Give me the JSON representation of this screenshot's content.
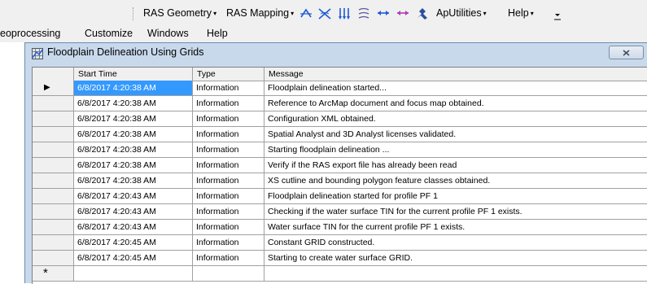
{
  "toolbar": {
    "ras_geometry": "RAS Geometry",
    "ras_mapping": "RAS Mapping",
    "apputilities": "ApUtilities",
    "help": "Help",
    "dropdown_glyph": "▾",
    "icons": [
      "xs-id-icon",
      "river-id-icon",
      "flow-arrows-icon",
      "flow-lines-icon",
      "bank-arrows-icon",
      "levee-arrows-icon",
      "hydraulic-tool-icon"
    ]
  },
  "menubar": {
    "geoprocessing": "eoprocessing",
    "customize": "Customize",
    "windows": "Windows",
    "help": "Help"
  },
  "window": {
    "title": "Floodplain Delineation Using Grids"
  },
  "table": {
    "columns": [
      "Start Time",
      "Type",
      "Message"
    ],
    "current_row_marker": "▶",
    "new_row_marker": "*",
    "rows": [
      {
        "time": "6/8/2017 4:20:38 AM",
        "type": "Information",
        "message": "Floodplain delineation started..."
      },
      {
        "time": "6/8/2017 4:20:38 AM",
        "type": "Information",
        "message": "Reference to ArcMap document and focus map obtained."
      },
      {
        "time": "6/8/2017 4:20:38 AM",
        "type": "Information",
        "message": "Configuration XML obtained."
      },
      {
        "time": "6/8/2017 4:20:38 AM",
        "type": "Information",
        "message": "Spatial Analyst and 3D Analyst licenses validated."
      },
      {
        "time": "6/8/2017 4:20:38 AM",
        "type": "Information",
        "message": "Starting floodplain delineation ..."
      },
      {
        "time": "6/8/2017 4:20:38 AM",
        "type": "Information",
        "message": "Verify if the RAS export file has already been read"
      },
      {
        "time": "6/8/2017 4:20:38 AM",
        "type": "Information",
        "message": "XS cutline and bounding polygon feature classes obtained."
      },
      {
        "time": "6/8/2017 4:20:43 AM",
        "type": "Information",
        "message": "Floodplain delineation started for profile PF 1"
      },
      {
        "time": "6/8/2017 4:20:43 AM",
        "type": "Information",
        "message": "Checking if the water surface TIN for the current profile PF 1 exists."
      },
      {
        "time": "6/8/2017 4:20:43 AM",
        "type": "Information",
        "message": "Water surface TIN for the current profile PF 1 exists."
      },
      {
        "time": "6/8/2017 4:20:45 AM",
        "type": "Information",
        "message": "Constant GRID constructed."
      },
      {
        "time": "6/8/2017 4:20:45 AM",
        "type": "Information",
        "message": "Starting to create water surface GRID."
      }
    ],
    "selection_color": "#3399ff"
  }
}
